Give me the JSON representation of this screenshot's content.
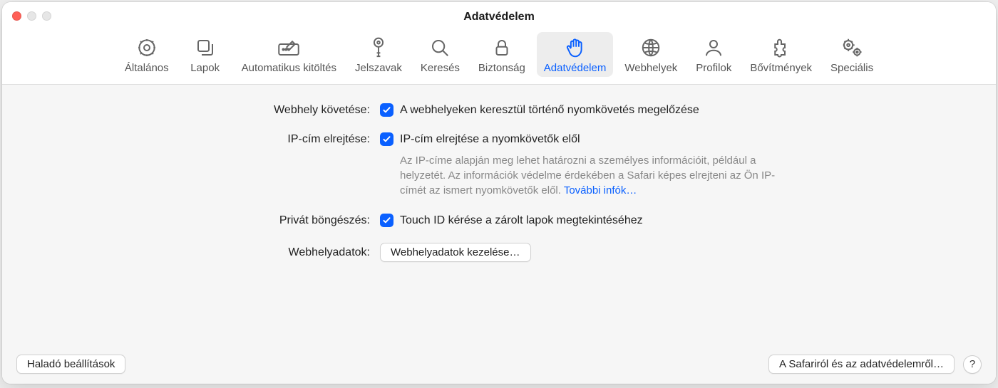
{
  "window": {
    "title": "Adatvédelem"
  },
  "tabs": [
    {
      "id": "general",
      "label": "Általános",
      "icon": "gear"
    },
    {
      "id": "tabs",
      "label": "Lapok",
      "icon": "square-stack"
    },
    {
      "id": "autofill",
      "label": "Automatikus kitöltés",
      "icon": "pencil-card"
    },
    {
      "id": "passwords",
      "label": "Jelszavak",
      "icon": "key"
    },
    {
      "id": "search",
      "label": "Keresés",
      "icon": "magnifier"
    },
    {
      "id": "security",
      "label": "Biztonság",
      "icon": "lock"
    },
    {
      "id": "privacy",
      "label": "Adatvédelem",
      "icon": "hand",
      "selected": true
    },
    {
      "id": "websites",
      "label": "Webhelyek",
      "icon": "globe"
    },
    {
      "id": "profiles",
      "label": "Profilok",
      "icon": "person"
    },
    {
      "id": "extensions",
      "label": "Bővítmények",
      "icon": "puzzle"
    },
    {
      "id": "advanced",
      "label": "Speciális",
      "icon": "gears"
    }
  ],
  "settings": {
    "tracking_label": "Webhely követése:",
    "tracking_checkbox_label": "A webhelyeken keresztül történő nyomkövetés megelőzése",
    "tracking_checked": true,
    "hideip_label": "IP-cím elrejtése:",
    "hideip_checkbox_label": "IP-cím elrejtése a nyomkövetők elől",
    "hideip_checked": true,
    "hideip_help": "Az IP-címe alapján meg lehet határozni a személyes információit, például a helyzetét. Az információk védelme érdekében a Safari képes elrejteni az Ön IP-címét az ismert nyomkövetők elől. ",
    "hideip_help_link": "További infók…",
    "private_label": "Privát böngészés:",
    "private_checkbox_label": "Touch ID kérése a zárolt lapok megtekintéséhez",
    "private_checked": true,
    "webdata_label": "Webhelyadatok:",
    "webdata_button": "Webhelyadatok kezelése…"
  },
  "footer": {
    "advanced_button": "Haladó beállítások",
    "about_button": "A Safariról és az adatvédelemről…",
    "help_button": "?"
  }
}
